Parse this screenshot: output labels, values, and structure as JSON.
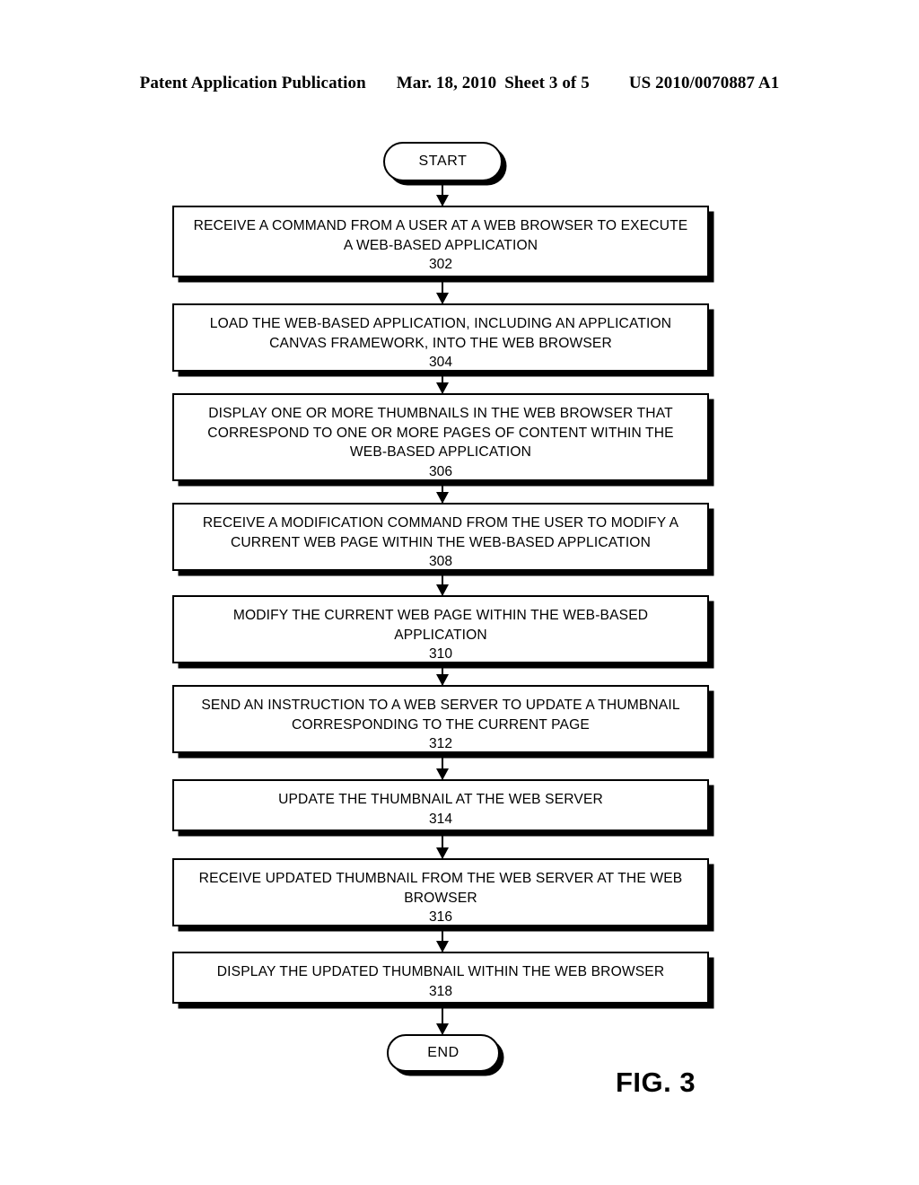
{
  "header": {
    "publication": "Patent Application Publication",
    "date": "Mar. 18, 2010",
    "sheet": "Sheet 3 of 5",
    "patent_number": "US 2010/0070887 A1"
  },
  "figure": {
    "label": "FIG. 3",
    "type": "flowchart",
    "start_label": "START",
    "end_label": "END"
  },
  "flowchart": {
    "nodes": [
      {
        "id": "start",
        "kind": "terminator",
        "label": "START"
      },
      {
        "id": "302",
        "kind": "process",
        "ref": "302",
        "lines": [
          "RECEIVE A COMMAND FROM A USER AT A WEB BROWSER TO EXECUTE",
          "A WEB-BASED APPLICATION"
        ]
      },
      {
        "id": "304",
        "kind": "process",
        "ref": "304",
        "lines": [
          "LOAD THE WEB-BASED APPLICATION, INCLUDING AN APPLICATION",
          "CANVAS FRAMEWORK, INTO THE WEB BROWSER"
        ]
      },
      {
        "id": "306",
        "kind": "process",
        "ref": "306",
        "lines": [
          "DISPLAY ONE OR MORE THUMBNAILS IN THE WEB BROWSER THAT",
          "CORRESPOND TO ONE OR MORE PAGES OF CONTENT WITHIN THE",
          "WEB-BASED APPLICATION"
        ]
      },
      {
        "id": "308",
        "kind": "process",
        "ref": "308",
        "lines": [
          "RECEIVE A MODIFICATION COMMAND FROM THE USER TO MODIFY A",
          "CURRENT WEB PAGE WITHIN THE WEB-BASED APPLICATION"
        ]
      },
      {
        "id": "310",
        "kind": "process",
        "ref": "310",
        "lines": [
          "MODIFY THE CURRENT WEB PAGE WITHIN THE WEB-BASED",
          "APPLICATION"
        ]
      },
      {
        "id": "312",
        "kind": "process",
        "ref": "312",
        "lines": [
          "SEND AN INSTRUCTION TO A WEB SERVER TO UPDATE A THUMBNAIL",
          "CORRESPONDING TO THE CURRENT PAGE"
        ]
      },
      {
        "id": "314",
        "kind": "process",
        "ref": "314",
        "lines": [
          "UPDATE THE THUMBNAIL AT THE WEB SERVER"
        ]
      },
      {
        "id": "316",
        "kind": "process",
        "ref": "316",
        "lines": [
          "RECEIVE UPDATED THUMBNAIL FROM THE WEB SERVER AT THE WEB",
          "BROWSER"
        ]
      },
      {
        "id": "318",
        "kind": "process",
        "ref": "318",
        "lines": [
          "DISPLAY THE UPDATED THUMBNAIL WITHIN THE WEB BROWSER"
        ]
      },
      {
        "id": "end",
        "kind": "terminator",
        "label": "END"
      }
    ]
  },
  "colors": {
    "ink": "#000000",
    "paper": "#ffffff"
  }
}
